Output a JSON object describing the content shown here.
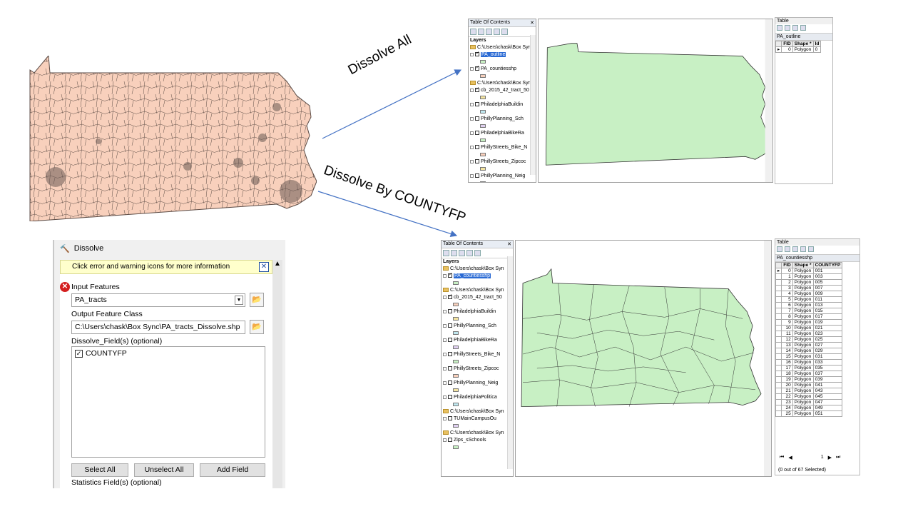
{
  "labels": {
    "dissolve_all": "Dissolve All",
    "dissolve_by": "Dissolve By COUNTYFP"
  },
  "colors": {
    "tracts_fill": "#f8d0bc",
    "outline_fill": "#c8f0c4",
    "arrow": "#4472c4"
  },
  "toc_top": {
    "title": "Table Of Contents",
    "layers_label": "Layers",
    "rows": [
      {
        "kind": "folder",
        "text": "C:\\Users\\chask\\Box Syn"
      },
      {
        "kind": "layer",
        "text": "PA_outline",
        "checked": true,
        "selected": true
      },
      {
        "kind": "layer",
        "text": "PA_countiesshp",
        "checked": true
      },
      {
        "kind": "folder",
        "text": "C:\\Users\\chask\\Box Syn"
      },
      {
        "kind": "layer",
        "text": "cb_2015_42_tract_50",
        "checked": true
      },
      {
        "kind": "layer",
        "text": "PhiladelphiaBuildin",
        "checked": false
      },
      {
        "kind": "layer",
        "text": "PhillyPlanning_Sch",
        "checked": false
      },
      {
        "kind": "layer",
        "text": "PhiladelphiaBikeRa",
        "checked": false
      },
      {
        "kind": "layer",
        "text": "PhillyStreets_Bike_N",
        "checked": false
      },
      {
        "kind": "layer",
        "text": "PhillyStreets_Zipcoc",
        "checked": false
      },
      {
        "kind": "layer",
        "text": "PhillyPlanning_Neig",
        "checked": false
      }
    ]
  },
  "table_top": {
    "header": "Table",
    "name": "PA_outline",
    "columns": [
      "FID",
      "Shape *",
      "Id"
    ],
    "rows": [
      [
        "0",
        "Polygon",
        "0"
      ]
    ]
  },
  "toc_bottom": {
    "title": "Table Of Contents",
    "layers_label": "Layers",
    "rows": [
      {
        "kind": "folder",
        "text": "C:\\Users\\chask\\Box Syn"
      },
      {
        "kind": "layer",
        "text": "PA_countiesshp",
        "checked": true,
        "selected": true
      },
      {
        "kind": "folder",
        "text": "C:\\Users\\chask\\Box Syn"
      },
      {
        "kind": "layer",
        "text": "cb_2015_42_tract_50",
        "checked": true
      },
      {
        "kind": "layer",
        "text": "PhiladelphiaBuildin",
        "checked": false
      },
      {
        "kind": "layer",
        "text": "PhillyPlanning_Sch",
        "checked": false
      },
      {
        "kind": "layer",
        "text": "PhiladelphiaBikeRa",
        "checked": false
      },
      {
        "kind": "layer",
        "text": "PhillyStreets_Bike_N",
        "checked": false
      },
      {
        "kind": "layer",
        "text": "PhillyStreets_Zipcoc",
        "checked": false
      },
      {
        "kind": "layer",
        "text": "PhillyPlanning_Neig",
        "checked": false
      },
      {
        "kind": "layer",
        "text": "PhiladelphiaPolitica",
        "checked": false
      },
      {
        "kind": "folder",
        "text": "C:\\Users\\chask\\Box Syn"
      },
      {
        "kind": "layer",
        "text": "TUMainCampusOu",
        "checked": false
      },
      {
        "kind": "folder",
        "text": "C:\\Users\\chask\\Box Syn"
      },
      {
        "kind": "layer",
        "text": "Zips_sSchools",
        "checked": false
      }
    ]
  },
  "table_bottom": {
    "header": "Table",
    "name": "PA_countiesshp",
    "columns": [
      "FID",
      "Shape *",
      "COUNTYFP"
    ],
    "rows": [
      [
        "0",
        "Polygon",
        "001"
      ],
      [
        "1",
        "Polygon",
        "003"
      ],
      [
        "2",
        "Polygon",
        "005"
      ],
      [
        "3",
        "Polygon",
        "007"
      ],
      [
        "4",
        "Polygon",
        "009"
      ],
      [
        "5",
        "Polygon",
        "011"
      ],
      [
        "6",
        "Polygon",
        "013"
      ],
      [
        "7",
        "Polygon",
        "015"
      ],
      [
        "8",
        "Polygon",
        "017"
      ],
      [
        "9",
        "Polygon",
        "019"
      ],
      [
        "10",
        "Polygon",
        "021"
      ],
      [
        "11",
        "Polygon",
        "023"
      ],
      [
        "12",
        "Polygon",
        "025"
      ],
      [
        "13",
        "Polygon",
        "027"
      ],
      [
        "14",
        "Polygon",
        "029"
      ],
      [
        "15",
        "Polygon",
        "031"
      ],
      [
        "16",
        "Polygon",
        "033"
      ],
      [
        "17",
        "Polygon",
        "035"
      ],
      [
        "18",
        "Polygon",
        "037"
      ],
      [
        "19",
        "Polygon",
        "039"
      ],
      [
        "20",
        "Polygon",
        "041"
      ],
      [
        "21",
        "Polygon",
        "043"
      ],
      [
        "22",
        "Polygon",
        "045"
      ],
      [
        "23",
        "Polygon",
        "047"
      ],
      [
        "24",
        "Polygon",
        "049"
      ],
      [
        "25",
        "Polygon",
        "051"
      ]
    ],
    "page_number": "1",
    "selection_status": "(0 out of 67 Selected)"
  },
  "dissolve_dialog": {
    "title": "Dissolve",
    "info_text": "Click error and warning icons for more information",
    "input_label": "Input Features",
    "input_value": "PA_tracts",
    "output_label": "Output Feature Class",
    "output_value": "C:\\Users\\chask\\Box Sync\\PA_tracts_Dissolve.shp",
    "dissolve_fields_label": "Dissolve_Field(s) (optional)",
    "fields": [
      {
        "name": "COUNTYFP",
        "checked": true
      }
    ],
    "select_all": "Select All",
    "unselect_all": "Unselect All",
    "add_field": "Add Field",
    "statistics_label": "Statistics Field(s) (optional)"
  }
}
